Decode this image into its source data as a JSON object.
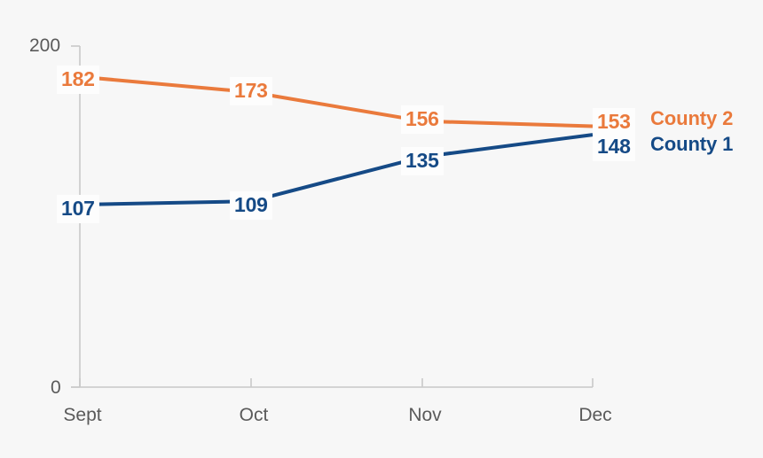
{
  "chart_data": {
    "type": "line",
    "title": "",
    "subtitle": "",
    "xlabel": "",
    "ylabel": "",
    "categories": [
      "Sept",
      "Oct",
      "Nov",
      "Dec"
    ],
    "ylim": [
      0,
      200
    ],
    "y_ticks": [
      "0",
      "200"
    ],
    "grid": false,
    "legend_position": "right",
    "background_color": "#f7f7f7",
    "series": [
      {
        "name": "County 2",
        "color": "#ea7a3c",
        "values": [
          182,
          173,
          156,
          153
        ],
        "labels": [
          "182",
          "173",
          "156",
          "153"
        ]
      },
      {
        "name": "County 1",
        "color": "#154a86",
        "values": [
          107,
          109,
          135,
          148
        ],
        "labels": [
          "107",
          "109",
          "135",
          "148"
        ]
      }
    ]
  },
  "axis": {
    "y_top_label": "200",
    "y_bottom_label": "0",
    "x_labels": [
      "Sept",
      "Oct",
      "Nov",
      "Dec"
    ],
    "axis_color": "#c9c9c9",
    "tick_text_color": "#5a5a5a"
  },
  "legend": {
    "items": [
      {
        "label": "County 2",
        "color": "#ea7a3c"
      },
      {
        "label": "County 1",
        "color": "#154a86"
      }
    ]
  },
  "data_labels": {
    "s2": [
      "182",
      "173",
      "156",
      "153"
    ],
    "s1": [
      "107",
      "109",
      "135",
      "148"
    ]
  }
}
